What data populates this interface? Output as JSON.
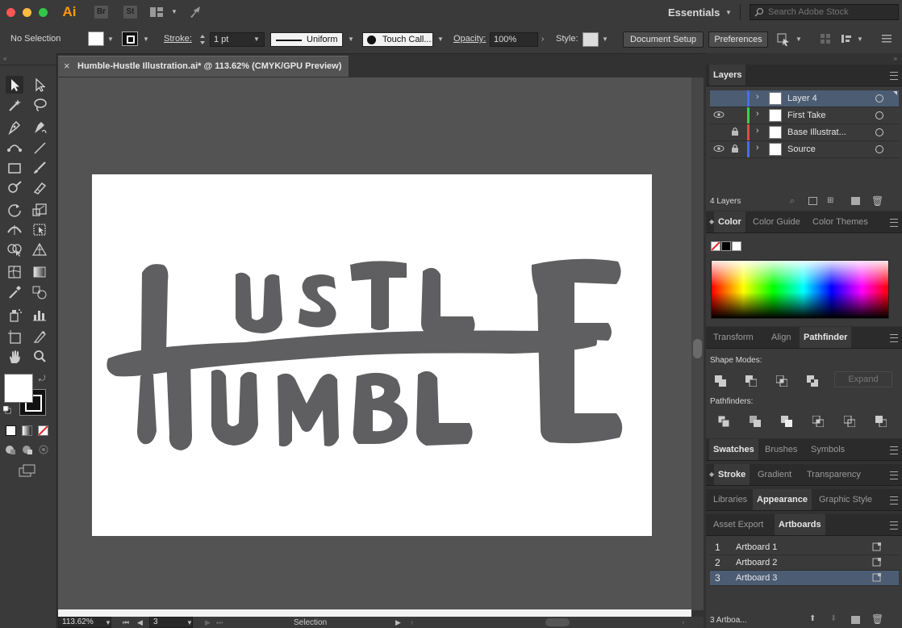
{
  "appbar": {
    "app_icon": "Ai",
    "bridge_badge": "Br",
    "stock_badge": "St",
    "workspace": "Essentials",
    "search_placeholder": "Search Adobe Stock"
  },
  "control": {
    "selection_label": "No Selection",
    "stroke_label": "Stroke:",
    "stroke_value": "1 pt",
    "stroke_profile": "Uniform",
    "brush": "Touch Call...",
    "opacity_label": "Opacity:",
    "opacity_value": "100%",
    "style_label": "Style:",
    "document_setup": "Document Setup",
    "preferences": "Preferences"
  },
  "document": {
    "tab_title": "Humble-Hustle Illustration.ai* @ 113.62% (CMYK/GPU Preview)",
    "close_glyph": "×"
  },
  "status": {
    "zoom": "113.62%",
    "artboard_nav": "3",
    "tool_name": "Selection"
  },
  "layers_panel": {
    "tab": "Layers",
    "layers": [
      {
        "name": "Layer 4",
        "color": "#4a6cf0",
        "visible": false,
        "locked": false,
        "selected": true
      },
      {
        "name": "First Take",
        "color": "#3ad24a",
        "visible": true,
        "locked": false,
        "selected": false
      },
      {
        "name": "Base Illustrat...",
        "color": "#e04a4a",
        "visible": false,
        "locked": true,
        "selected": false
      },
      {
        "name": "Source",
        "color": "#4a6cf0",
        "visible": true,
        "locked": true,
        "selected": false
      }
    ],
    "count": "4 Layers"
  },
  "color_panel": {
    "tabs": [
      "Color",
      "Color Guide",
      "Color Themes"
    ]
  },
  "pathfinder_panel": {
    "tabs": [
      "Transform",
      "Align",
      "Pathfinder"
    ],
    "shape_modes_label": "Shape Modes:",
    "expand_label": "Expand",
    "pathfinders_label": "Pathfinders:"
  },
  "swatches_tabs": [
    "Swatches",
    "Brushes",
    "Symbols"
  ],
  "stroke_tabs": [
    "Stroke",
    "Gradient",
    "Transparency"
  ],
  "appearance_tabs": [
    "Libraries",
    "Appearance",
    "Graphic Style"
  ],
  "artboards_panel": {
    "tabs": [
      "Asset Export",
      "Artboards"
    ],
    "items": [
      {
        "num": "1",
        "name": "Artboard 1",
        "selected": false
      },
      {
        "num": "2",
        "name": "Artboard 2",
        "selected": false
      },
      {
        "num": "3",
        "name": "Artboard 3",
        "selected": true
      }
    ],
    "footer": "3 Artboa..."
  },
  "colors": {
    "accent": "#4b5c73",
    "artwork": "#5f5f61"
  }
}
